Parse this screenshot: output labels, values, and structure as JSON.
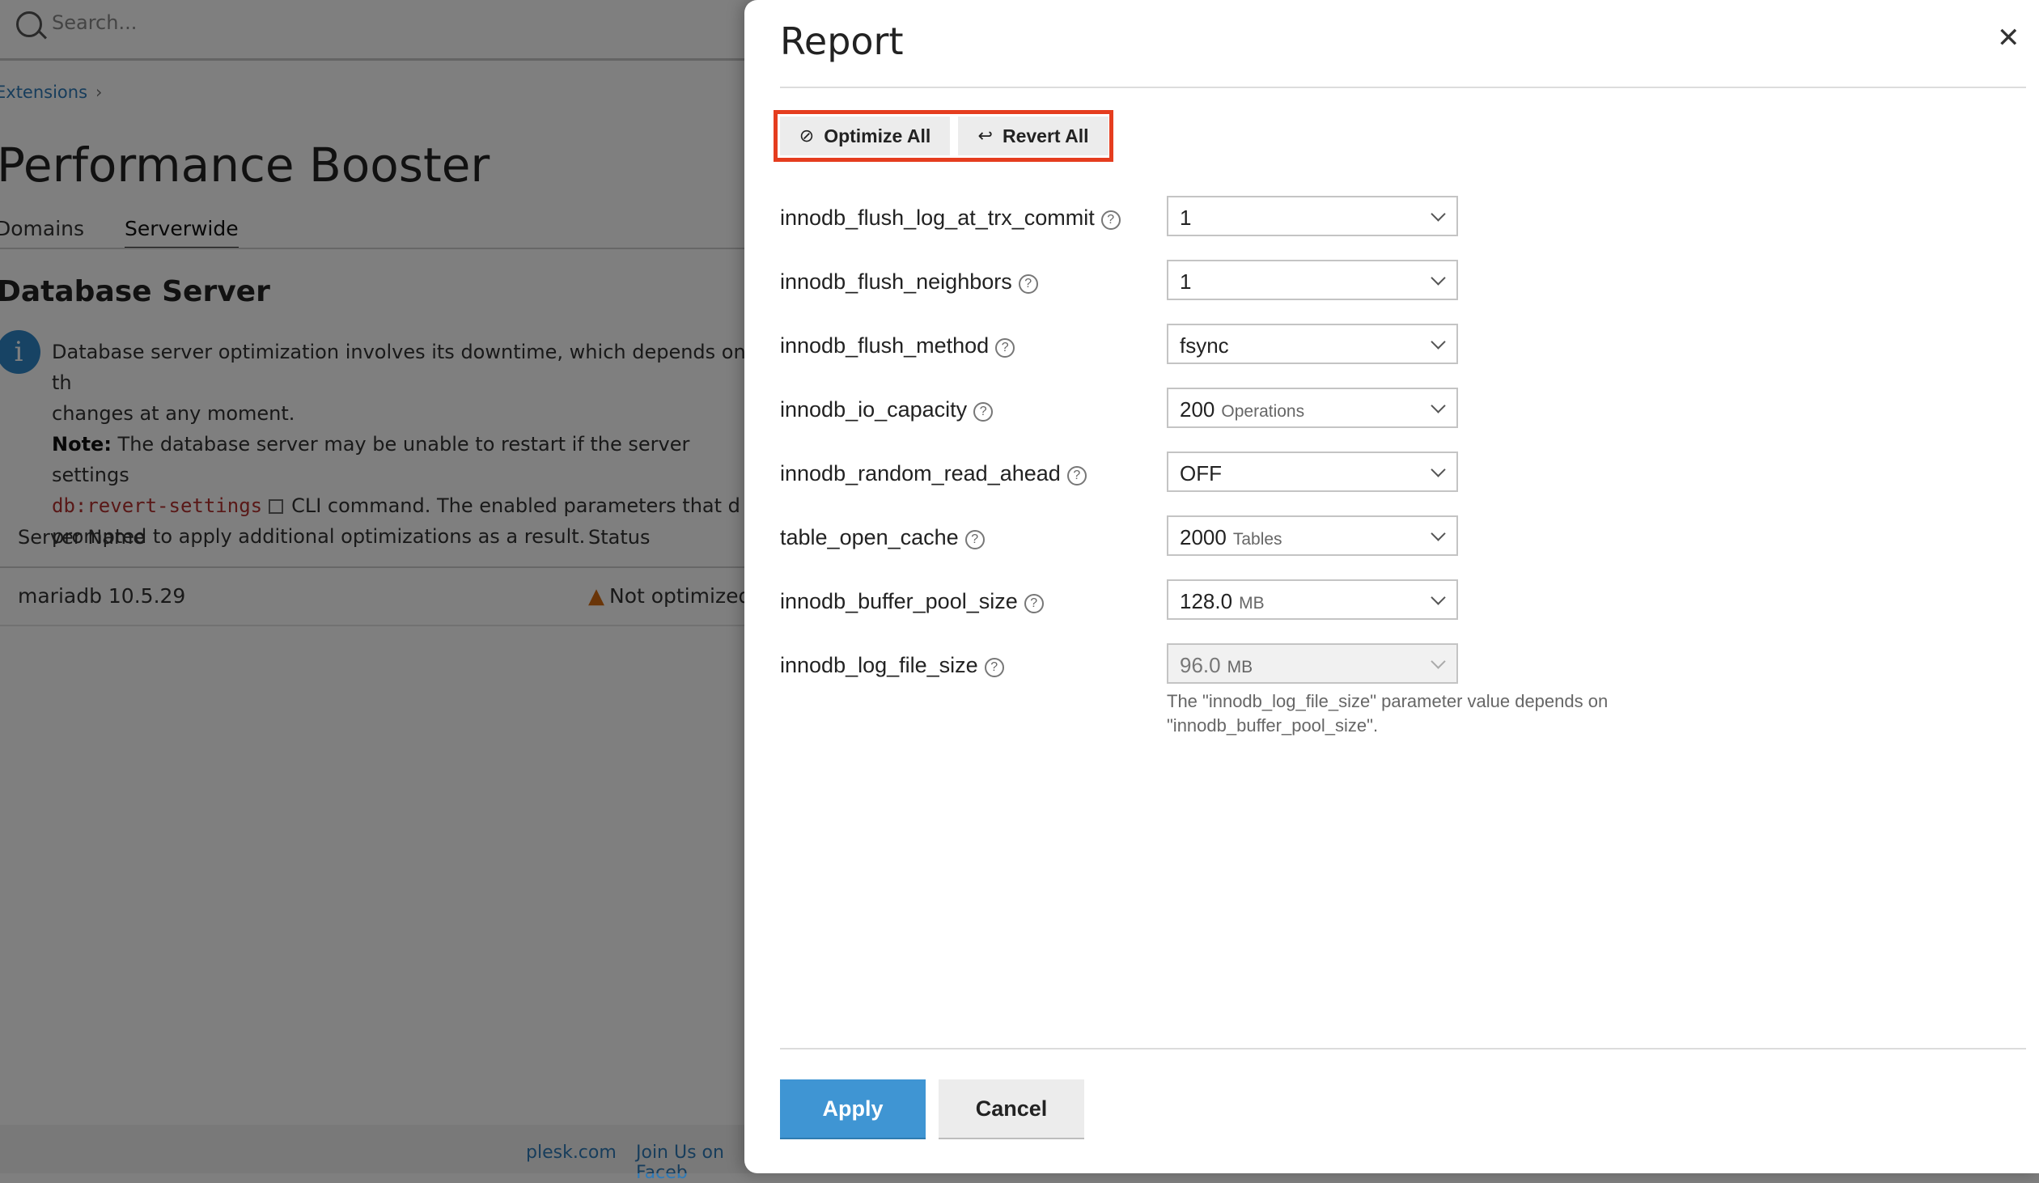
{
  "background": {
    "search_placeholder": "Search...",
    "breadcrumb": "Extensions",
    "page_title": "Performance Booster",
    "tabs": [
      "Domains",
      "Serverwide"
    ],
    "section_title": "Database Server",
    "info": {
      "line1": "Database server optimization involves its downtime, which depends on th",
      "line2": "changes at any moment.",
      "note_label": "Note:",
      "line3": " The database server may be unable to restart if the server settings",
      "code": "db:revert-settings",
      "line4": "CLI command. The enabled parameters that d",
      "line5": "prompted to apply additional optimizations as a result."
    },
    "table": {
      "columns": [
        "Server Name",
        "Status"
      ],
      "rows": [
        {
          "server": "mariadb 10.5.29",
          "status": "Not optimized"
        }
      ]
    },
    "footer": {
      "links": [
        "plesk.com",
        "Join Us on Faceb"
      ]
    }
  },
  "panel": {
    "title": "Report",
    "toolbar": {
      "optimize_all": "Optimize All",
      "revert_all": "Revert All"
    },
    "params": [
      {
        "label": "innodb_flush_log_at_trx_commit",
        "value": "1",
        "unit": "",
        "disabled": false
      },
      {
        "label": "innodb_flush_neighbors",
        "value": "1",
        "unit": "",
        "disabled": false
      },
      {
        "label": "innodb_flush_method",
        "value": "fsync",
        "unit": "",
        "disabled": false
      },
      {
        "label": "innodb_io_capacity",
        "value": "200",
        "unit": "Operations",
        "disabled": false
      },
      {
        "label": "innodb_random_read_ahead",
        "value": "OFF",
        "unit": "",
        "disabled": false
      },
      {
        "label": "table_open_cache",
        "value": "2000",
        "unit": "Tables",
        "disabled": false
      },
      {
        "label": "innodb_buffer_pool_size",
        "value": "128.0",
        "unit": "MB",
        "disabled": false
      },
      {
        "label": "innodb_log_file_size",
        "value": "96.0",
        "unit": "MB",
        "disabled": true
      }
    ],
    "hint": "The \"innodb_log_file_size\" parameter value depends on \"innodb_buffer_pool_size\".",
    "apply_label": "Apply",
    "cancel_label": "Cancel"
  },
  "colors": {
    "accent": "#3f95d3",
    "highlight": "#e53d1f",
    "warning": "#d46b10"
  }
}
